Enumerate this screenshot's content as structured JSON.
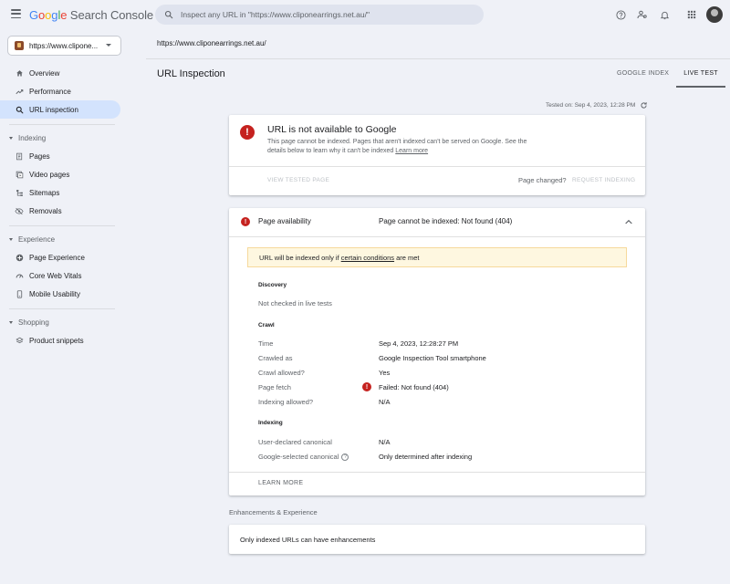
{
  "header": {
    "logo_google": [
      "G",
      "o",
      "o",
      "g",
      "l",
      "e"
    ],
    "logo_product": "Search Console",
    "search_placeholder": "Inspect any URL in \"https://www.cliponearrings.net.au/\""
  },
  "sidebar": {
    "property": "https://www.clipone...",
    "items": [
      {
        "label": "Overview",
        "icon": "home-icon"
      },
      {
        "label": "Performance",
        "icon": "trending-icon"
      },
      {
        "label": "URL inspection",
        "icon": "search-icon",
        "active": true
      }
    ],
    "sections": [
      {
        "title": "Indexing",
        "items": [
          {
            "label": "Pages",
            "icon": "pages-icon"
          },
          {
            "label": "Video pages",
            "icon": "video-pages-icon"
          },
          {
            "label": "Sitemaps",
            "icon": "sitemap-icon"
          },
          {
            "label": "Removals",
            "icon": "removals-icon"
          }
        ]
      },
      {
        "title": "Experience",
        "items": [
          {
            "label": "Page Experience",
            "icon": "page-experience-icon"
          },
          {
            "label": "Core Web Vitals",
            "icon": "gauge-icon"
          },
          {
            "label": "Mobile Usability",
            "icon": "mobile-icon"
          }
        ]
      },
      {
        "title": "Shopping",
        "items": [
          {
            "label": "Product snippets",
            "icon": "layers-icon"
          }
        ]
      }
    ]
  },
  "main": {
    "url": "https://www.cliponearrings.net.au/",
    "title": "URL Inspection",
    "tabs": [
      "GOOGLE INDEX",
      "LIVE TEST"
    ],
    "tested_on": "Tested on: Sep 4, 2023, 12:28 PM",
    "status_card": {
      "title": "URL is not available to Google",
      "desc": "This page cannot be indexed. Pages that aren't indexed can't be served on Google. See the details below to learn why it can't be indexed",
      "learn_more": "Learn more",
      "view_tested": "VIEW TESTED PAGE",
      "page_changed": "Page changed?",
      "request_indexing": "REQUEST INDEXING"
    },
    "availability": {
      "label": "Page availability",
      "value": "Page cannot be indexed: Not found (404)",
      "banner_pre": "URL will be indexed only if",
      "banner_link": "certain conditions",
      "banner_post": "are met",
      "discovery_title": "Discovery",
      "discovery_text": "Not checked in live tests",
      "crawl_title": "Crawl",
      "crawl_rows": [
        {
          "label": "Time",
          "value": "Sep 4, 2023, 12:28:27 PM"
        },
        {
          "label": "Crawled as",
          "value": "Google Inspection Tool smartphone"
        },
        {
          "label": "Crawl allowed?",
          "value": "Yes"
        },
        {
          "label": "Page fetch",
          "value": "Failed: Not found (404)"
        },
        {
          "label": "Indexing allowed?",
          "value": "N/A"
        }
      ],
      "indexing_title": "Indexing",
      "indexing_rows": [
        {
          "label": "User-declared canonical",
          "value": "N/A"
        },
        {
          "label": "Google-selected canonical",
          "value": "Only determined after indexing"
        }
      ],
      "learn_more": "LEARN MORE"
    },
    "enhancements_title": "Enhancements & Experience",
    "enhancements_text": "Only indexed URLs can have enhancements"
  }
}
